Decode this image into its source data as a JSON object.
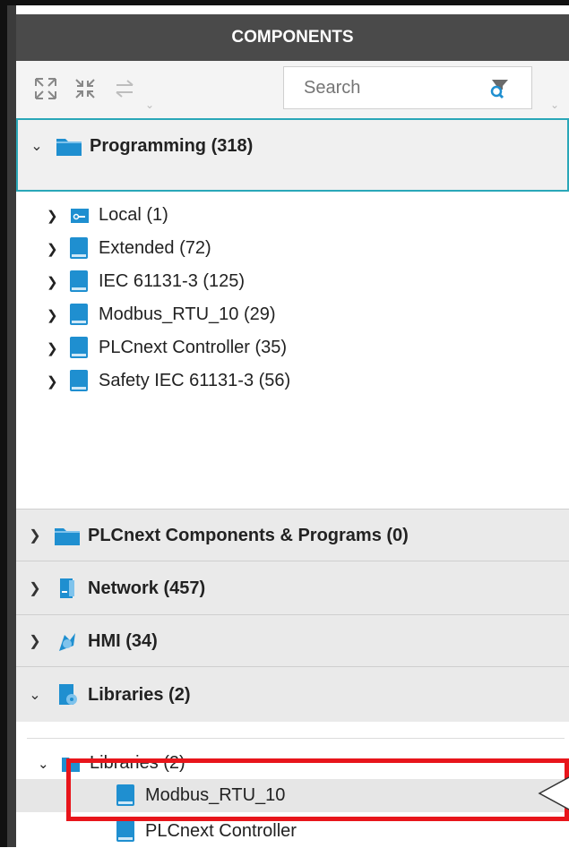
{
  "panel": {
    "title": "COMPONENTS"
  },
  "toolbar": {
    "expand_icon": "expand-all-icon",
    "collapse_icon": "collapse-all-icon",
    "sync_icon": "sync-arrows-icon",
    "search_placeholder": "Search",
    "filter_icon": "filter-search-icon"
  },
  "sections": {
    "programming": {
      "label": "Programming (318)",
      "expanded": true,
      "items": [
        {
          "label": "Local (1)",
          "icon": "local-folder-icon"
        },
        {
          "label": "Extended (72)",
          "icon": "library-book-icon"
        },
        {
          "label": "IEC 61131-3 (125)",
          "icon": "library-book-icon"
        },
        {
          "label": "Modbus_RTU_10 (29)",
          "icon": "library-book-icon"
        },
        {
          "label": "PLCnext Controller (35)",
          "icon": "library-book-icon"
        },
        {
          "label": "Safety IEC 61131-3 (56)",
          "icon": "library-book-icon"
        }
      ]
    },
    "plcnext": {
      "label": "PLCnext Components & Programs (0)",
      "expanded": false
    },
    "network": {
      "label": "Network (457)",
      "expanded": false
    },
    "hmi": {
      "label": "HMI (34)",
      "expanded": false
    },
    "libraries": {
      "label": "Libraries (2)",
      "expanded": true,
      "subfolder": {
        "label": "Libraries (2)"
      },
      "items": [
        {
          "label": "Modbus_RTU_10",
          "selected": true
        },
        {
          "label": "PLCnext Controller",
          "selected": false
        }
      ]
    }
  },
  "colors": {
    "header_bg": "#4a4a4a",
    "accent": "#1f8fd0",
    "highlight": "#e8151b",
    "selected_bg": "#e6e6e6"
  }
}
